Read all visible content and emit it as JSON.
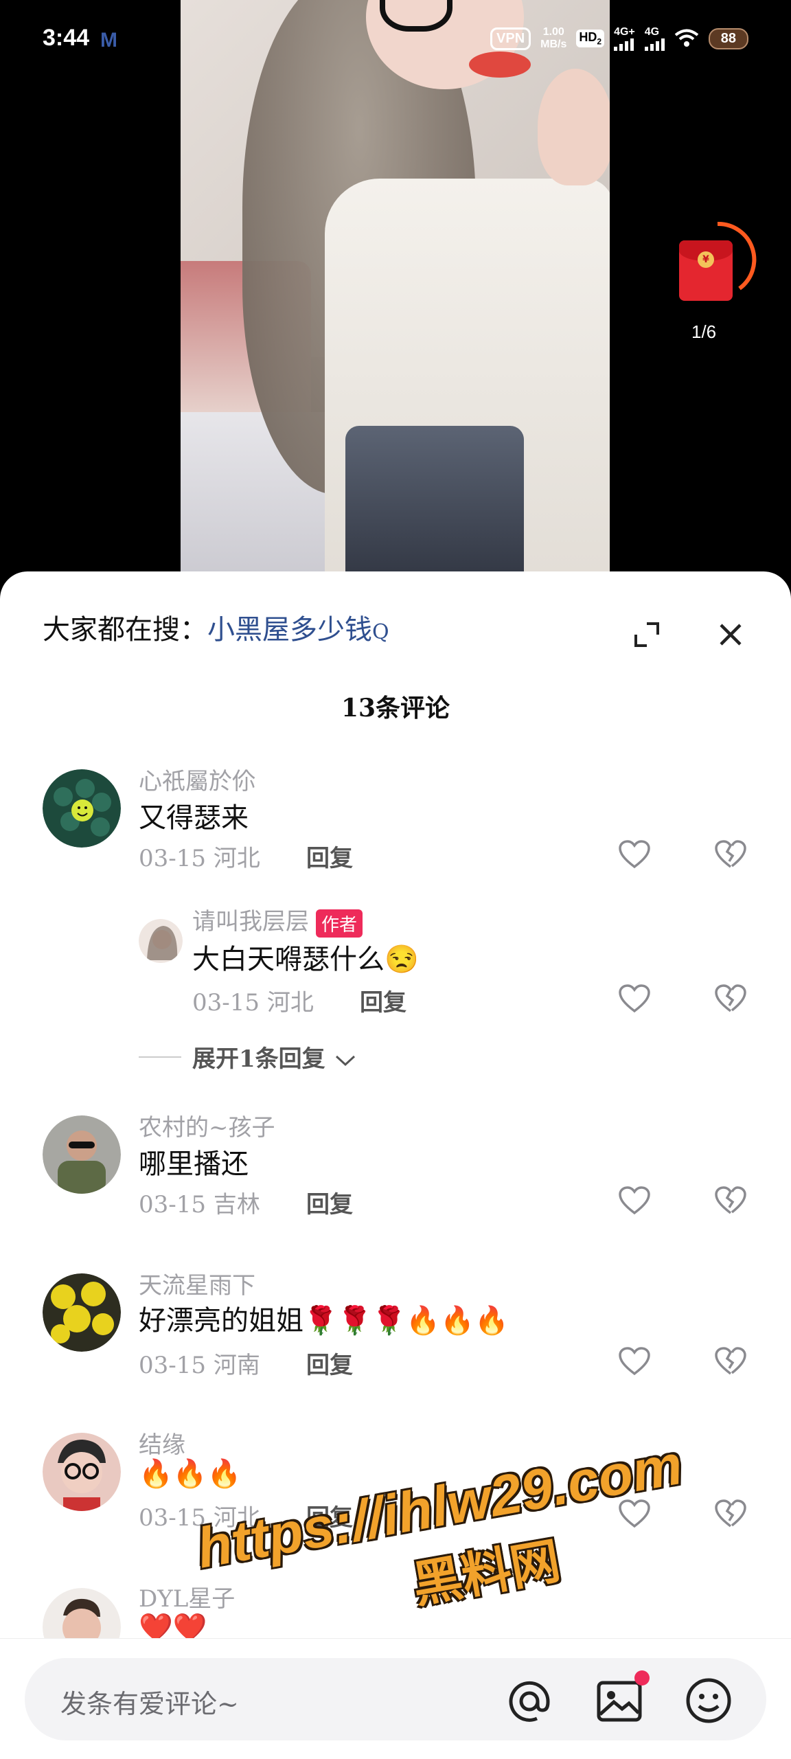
{
  "status_bar": {
    "time": "3:44",
    "mail_icon": "M",
    "vpn": "VPN",
    "speed_value": "1.00",
    "speed_unit": "MB/s",
    "hd": "HD",
    "hd_sub": "2",
    "network_1": "4G+",
    "network_2": "4G",
    "battery": "88"
  },
  "red_packet": {
    "progress_label": "1/6",
    "icon": "red-envelope-icon"
  },
  "sheet": {
    "search_prefix": "大家都在搜：",
    "search_keyword": "小黑屋多少钱",
    "search_icon": "Q",
    "comment_count_title": "13条评论"
  },
  "comments": [
    {
      "user": "心祇屬於伱",
      "text": "又得瑟来",
      "date": "03-15",
      "location": "河北",
      "reply_label": "回复"
    },
    {
      "user": "请叫我层层",
      "author_tag": "作者",
      "text": "大白天嘚瑟什么😒",
      "date": "03-15",
      "location": "河北",
      "reply_label": "回复"
    },
    {
      "expand_label": "展开1条回复"
    },
    {
      "user": "农村的~孩子",
      "text": "哪里播还",
      "date": "03-15",
      "location": "吉林",
      "reply_label": "回复"
    },
    {
      "user": "天流星雨下",
      "text": "好漂亮的姐姐🌹🌹🌹🔥🔥🔥",
      "date": "03-15",
      "location": "河南",
      "reply_label": "回复"
    },
    {
      "user": "结缘",
      "text": "🔥🔥🔥",
      "date": "03-15",
      "location": "河北",
      "reply_label": "回复"
    },
    {
      "user": "DYL星子",
      "text": "❤️❤️"
    }
  ],
  "watermark": {
    "url": "https://ihlw29.com",
    "name": "黑料网"
  },
  "input_bar": {
    "placeholder": "发条有爱评论~"
  },
  "colors": {
    "accent": "#ee2b5a",
    "link": "#2f4f8f",
    "muted": "#a1a1a6"
  }
}
